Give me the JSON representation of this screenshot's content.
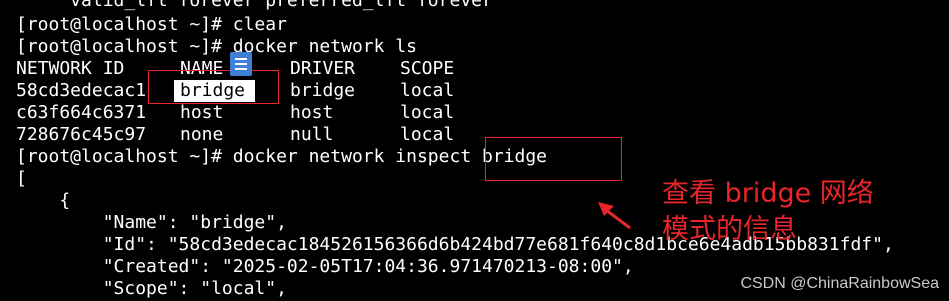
{
  "terminal": {
    "lines": [
      "     valid_lft forever preferred_lft forever",
      "[root@localhost ~]# clear",
      "[root@localhost ~]# docker network ls",
      "",
      "",
      "",
      "",
      "[root@localhost ~]# docker network inspect bridge",
      "[",
      "    {",
      "        \"Name\": \"bridge\",",
      "        \"Id\": \"58cd3edecac184526156366d6b424bd77e681f640c8d1bce6e4adb15bb831fdf\",",
      "        \"Created\": \"2025-02-05T17:04:36.971470213-08:00\",",
      "        \"Scope\": \"local\","
    ],
    "network_table": {
      "headers": [
        "NETWORK ID",
        "NAME",
        "DRIVER",
        "SCOPE"
      ],
      "rows": [
        [
          "58cd3edecac1",
          "bridge",
          "bridge",
          "local"
        ],
        [
          "c63f664c6371",
          "host",
          "host",
          "local"
        ],
        [
          "728676c45c97",
          "none",
          "null",
          "local"
        ]
      ]
    }
  },
  "annotation": {
    "text": "查看 bridge 网络\n模式的信息",
    "color": "#e8262a"
  },
  "watermark": "CSDN @ChinaRainbowSea",
  "overlay_icons": [
    "document-icon"
  ]
}
